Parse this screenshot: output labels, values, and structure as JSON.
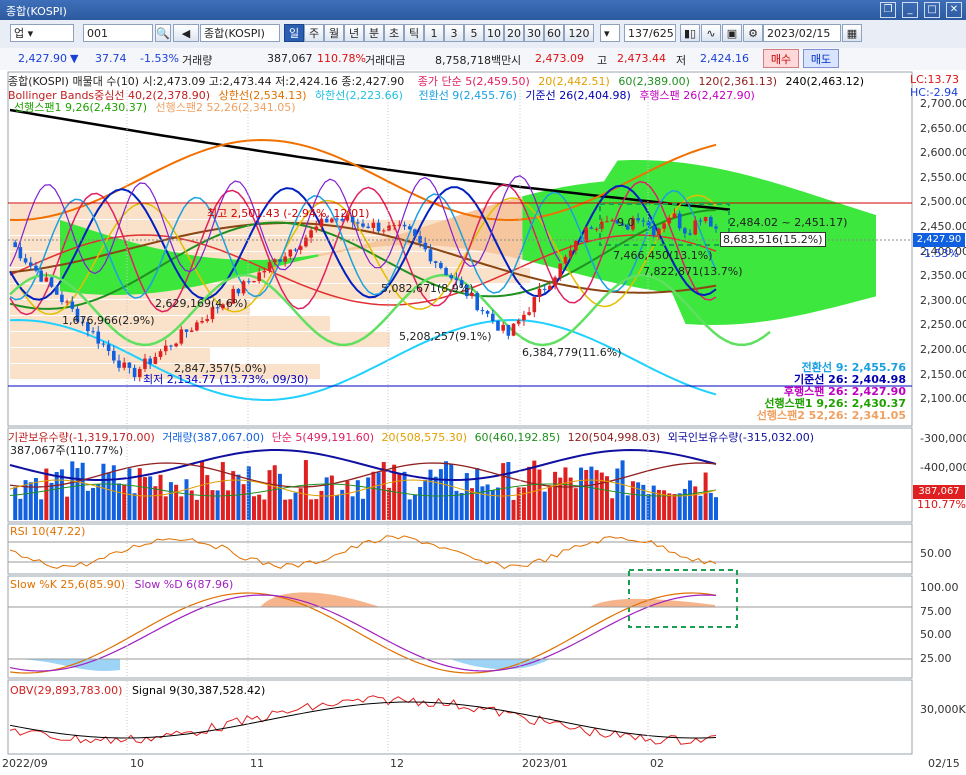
{
  "window": {
    "title": "종합(KOSPI)"
  },
  "toolbar": {
    "mode": "업",
    "code": "001",
    "nav_label": "전",
    "name": "종합(KOSPI)",
    "period_tabs": [
      "일",
      "주",
      "월",
      "년",
      "분",
      "초",
      "틱"
    ],
    "period_selected": "일",
    "intervals": [
      "1",
      "3",
      "5",
      "10",
      "20",
      "30",
      "60",
      "120"
    ],
    "count": "137/625",
    "date": "2023/02/15"
  },
  "quote": {
    "price": "2,427.90",
    "change": "37.74",
    "change_pct": "-1.53%",
    "volume_label": "거래량",
    "volume": "387,067",
    "volume_ratio": "110.78%",
    "amount_label": "거래대금",
    "amount": "8,758,718백만",
    "open_label": "시",
    "open": "2,473.09",
    "high_label": "고",
    "high": "2,473.44",
    "low_label": "저",
    "low": "2,424.16",
    "buy": "매수",
    "sell": "매도"
  },
  "price_panel": {
    "legend_line1": {
      "a": "종합(KOSPI) 매물대 수(10)  시:2,473.09 고:2,473.44 저:2,424.16 종:2,427.90",
      "b": "종가 단순 5(2,459.50)",
      "c": "20(2,442.51)",
      "d": "60(2,389.00)",
      "e": "120(2,361.13)",
      "f": "240(2,463.12)"
    },
    "legend_line2": {
      "a": "Bollinger Bands중심선 40,2(2,378.90)",
      "b": "상한선(2,534.13)",
      "c": "하한선(2,223.66)",
      "d": "전환선 9(2,455.76)",
      "e": "기준선 26(2,404.98)",
      "f": "후행스팬 26(2,427.90)"
    },
    "legend_line3": {
      "a": "선행스팬1 9,26(2,430.37)",
      "b": "선행스팬2 52,26(2,341.05)"
    },
    "lc": "LC:13.73",
    "hc": "HC:-2.94",
    "y_ticks": [
      "2,700.00",
      "2,650.00",
      "2,600.00",
      "2,550.00",
      "2,500.00",
      "2,450.00",
      "2,400.00",
      "2,350.00",
      "2,300.00",
      "2,250.00",
      "2,200.00",
      "2,150.00",
      "2,100.00"
    ],
    "last_price_tag": "2,427.90",
    "last_pct_tag": "-1.53%",
    "annotations": {
      "high": "최고 2,501.43 (-2.94%, 12/01)",
      "low": "최저 2,134.77 (13.73%, 09/30)",
      "vp1": "2,629,169(4.6%)",
      "vp2": "1,676,966(2.9%)",
      "vp3": "2,847,357(5.0%)",
      "vp4": "5,082,671(8.9%)",
      "vp5": "5,208,257(9.1%)",
      "vp6": "6,384,779(11.6%)",
      "vp7": "7,466,450(13.1%)",
      "vp8": "7,822,871(13.7%)",
      "vp9": "8,683,516(15.2%)",
      "range_top": "9,0",
      "range_text": "2,484.02 ~ 2,451.17)"
    },
    "right_summary": [
      {
        "label": "전환선 9: 2,455.76",
        "color": "#1aa0e0"
      },
      {
        "label": "기준선 26: 2,404.98",
        "color": "#0000b0"
      },
      {
        "label": "후행스팬 26: 2,427.90",
        "color": "#c000c0"
      },
      {
        "label": "선행스팬1 9,26: 2,430.37",
        "color": "#20a000"
      },
      {
        "label": "선행스팬2 52,26: 2,341.05",
        "color": "#f0a060"
      }
    ]
  },
  "volume_panel": {
    "legend_a": "기관보유수량(-1,319,170.00)",
    "legend_b": "거래량(387,067.00)",
    "legend_c": "단순 5(499,191.60)",
    "legend_d": "20(508,575.30)",
    "legend_e": "60(460,192.85)",
    "legend_f": "120(504,998.03)",
    "legend_g": "외국인보유수량(-315,032.00)",
    "legend_h": "387,067주(110.77%)",
    "y_ticks": [
      "-300,000",
      "-400,000"
    ],
    "tag_value": "387,067",
    "tag_pct": "110.77%"
  },
  "rsi_panel": {
    "legend": "RSI 10(47.22)",
    "y_ticks": [
      "50.00"
    ]
  },
  "stoch_panel": {
    "legend_k": "Slow %K 25,6(85.90)",
    "legend_d": "Slow %D 6(87.96)",
    "y_ticks": [
      "100.00",
      "75.00",
      "50.00",
      "25.00"
    ]
  },
  "obv_panel": {
    "legend_a": "OBV(29,893,783.00)",
    "legend_b": "Signal 9(30,387,528.42)",
    "y_ticks": [
      "30,000K"
    ]
  },
  "x_axis": {
    "labels": [
      "2022/09",
      "10",
      "11",
      "12",
      "2023/01",
      "02",
      "02/15"
    ]
  },
  "colors": {
    "up": "#e02020",
    "down": "#1060e0",
    "accent": "#2a5eb3"
  }
}
